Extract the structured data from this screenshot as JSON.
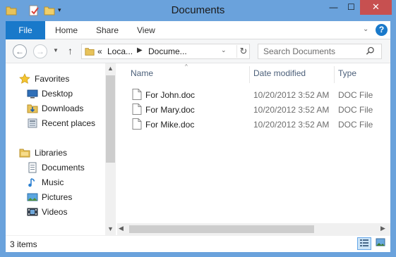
{
  "window": {
    "title": "Documents",
    "controls": {
      "minimize": "—",
      "maximize": "☐",
      "close": "✕"
    }
  },
  "ribbon": {
    "tabs": [
      {
        "label": "File"
      },
      {
        "label": "Home"
      },
      {
        "label": "Share"
      },
      {
        "label": "View"
      }
    ],
    "help": "?"
  },
  "navigation": {
    "address": {
      "overflow": "«",
      "segments": [
        "Loca...",
        "Docume..."
      ]
    },
    "search": {
      "placeholder": "Search Documents"
    }
  },
  "sidebar": {
    "groups": [
      {
        "label": "Favorites",
        "icon": "star-icon",
        "items": [
          {
            "label": "Desktop",
            "icon": "desktop-icon"
          },
          {
            "label": "Downloads",
            "icon": "downloads-icon"
          },
          {
            "label": "Recent places",
            "icon": "recent-places-icon"
          }
        ]
      },
      {
        "label": "Libraries",
        "icon": "libraries-icon",
        "items": [
          {
            "label": "Documents",
            "icon": "documents-icon"
          },
          {
            "label": "Music",
            "icon": "music-icon"
          },
          {
            "label": "Pictures",
            "icon": "pictures-icon"
          },
          {
            "label": "Videos",
            "icon": "videos-icon"
          }
        ]
      }
    ]
  },
  "file_list": {
    "columns": [
      "Name",
      "Date modified",
      "Type"
    ],
    "rows": [
      {
        "name": "For John.doc",
        "date_modified": "10/20/2012 3:52 AM",
        "type": "DOC File"
      },
      {
        "name": "For Mary.doc",
        "date_modified": "10/20/2012 3:52 AM",
        "type": "DOC File"
      },
      {
        "name": "For Mike.doc",
        "date_modified": "10/20/2012 3:52 AM",
        "type": "DOC File"
      }
    ]
  },
  "status_bar": {
    "item_count": "3 items"
  },
  "colors": {
    "frame": "#6aa2dc",
    "file_tab": "#1979ca",
    "close_button": "#c75050",
    "column_header_text": "#4c607a"
  }
}
